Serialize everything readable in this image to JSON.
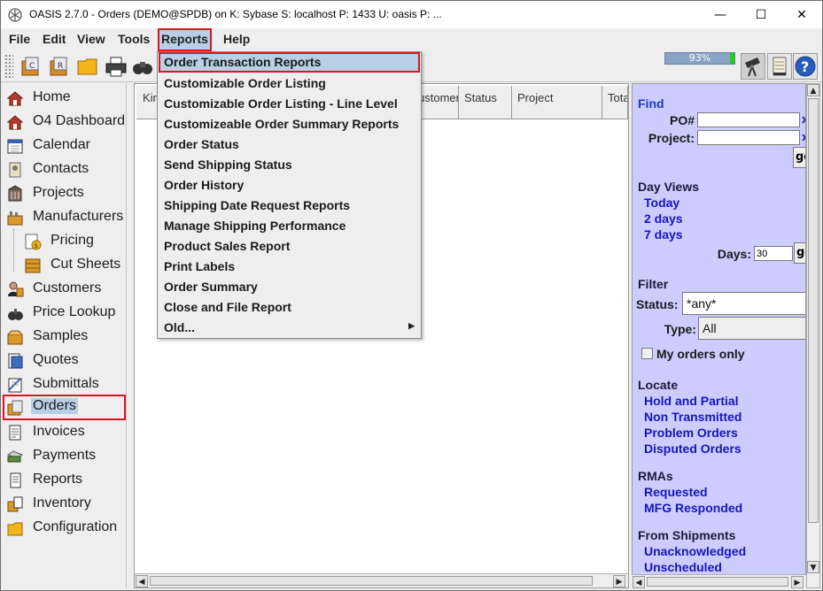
{
  "window": {
    "title": "OASIS 2.7.0 - Orders (DEMO@SPDB) on K: Sybase  S: localhost  P: 1433  U: oasis  P: ...",
    "minimize_glyph": "—",
    "maximize_glyph": "☐",
    "close_glyph": "✕"
  },
  "menubar": {
    "items": [
      "File",
      "Edit",
      "View",
      "Tools",
      "Reports",
      "Help"
    ],
    "active": "Reports"
  },
  "toolbar": {
    "progress_text": "93%",
    "progress_value": 93,
    "icons": [
      "contacts-card-icon",
      "reports-card-icon",
      "folder-icon",
      "printer-icon",
      "binoculars-icon"
    ],
    "right_icons": [
      "telescope-icon",
      "notepad-icon",
      "help-icon"
    ]
  },
  "sidebar": {
    "items": [
      {
        "label": "Home",
        "icon": "home-icon"
      },
      {
        "label": "O4 Dashboard",
        "icon": "dashboard-icon"
      },
      {
        "label": "Calendar",
        "icon": "calendar-icon"
      },
      {
        "label": "Contacts",
        "icon": "contacts-icon"
      },
      {
        "label": "Projects",
        "icon": "projects-icon"
      },
      {
        "label": "Manufacturers",
        "icon": "manufacturers-icon"
      },
      {
        "label": "Pricing",
        "icon": "pricing-icon"
      },
      {
        "label": "Cut Sheets",
        "icon": "cut-sheets-icon"
      },
      {
        "label": "Customers",
        "icon": "customers-icon"
      },
      {
        "label": "Price Lookup",
        "icon": "price-lookup-icon"
      },
      {
        "label": "Samples",
        "icon": "samples-icon"
      },
      {
        "label": "Quotes",
        "icon": "quotes-icon"
      },
      {
        "label": "Submittals",
        "icon": "submittals-icon"
      },
      {
        "label": "Orders",
        "icon": "orders-icon"
      },
      {
        "label": "Invoices",
        "icon": "invoices-icon"
      },
      {
        "label": "Payments",
        "icon": "payments-icon"
      },
      {
        "label": "Reports",
        "icon": "reports-icon"
      },
      {
        "label": "Inventory",
        "icon": "inventory-icon"
      },
      {
        "label": "Configuration",
        "icon": "configuration-icon"
      }
    ],
    "selected": "Orders"
  },
  "table": {
    "columns": [
      "Kin",
      "ustomer",
      "Status",
      "Project",
      "Tota"
    ]
  },
  "reports_menu": {
    "items": [
      "Order Transaction Reports",
      "Customizable Order Listing",
      "Customizable Order Listing - Line Level",
      "Customizeable Order Summary Reports",
      "Order Status",
      "Send Shipping Status",
      "Order History",
      "Shipping Date Request Reports",
      "Manage Shipping Performance",
      "Product Sales Report",
      "Print Labels",
      "Order Summary",
      "Close and File Report",
      "Old..."
    ],
    "highlighted": "Order Transaction Reports",
    "submenu_arrow": "▶"
  },
  "right_panel": {
    "find": {
      "heading": "Find",
      "po_label": "PO#",
      "project_label": "Project:",
      "po_value": "",
      "project_value": "",
      "clear_glyph": "x",
      "go_label": "go"
    },
    "day_views": {
      "heading": "Day Views",
      "links": [
        "Today",
        "2 days",
        "7 days"
      ],
      "days_label": "Days:",
      "days_value": "30",
      "go_label": "go"
    },
    "filter": {
      "heading": "Filter",
      "status_label": "Status:",
      "status_value": "*any*",
      "type_label": "Type:",
      "type_value": "All",
      "my_orders_label": "My orders only",
      "my_orders_checked": false
    },
    "locate": {
      "heading": "Locate",
      "links": [
        "Hold and Partial",
        "Non Transmitted",
        "Problem Orders",
        "Disputed Orders"
      ]
    },
    "rmas": {
      "heading": "RMAs",
      "links": [
        "Requested",
        "MFG Responded"
      ]
    },
    "from_shipments": {
      "heading": "From Shipments",
      "links": [
        "Unacknowledged",
        "Unscheduled"
      ]
    }
  }
}
